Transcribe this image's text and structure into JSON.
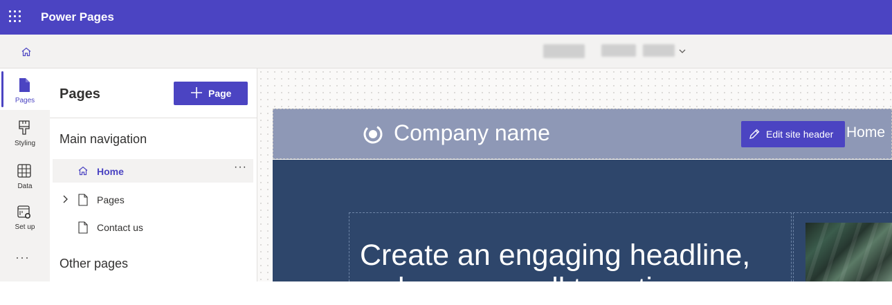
{
  "app": {
    "title": "Power Pages",
    "accent_color": "#4b44c2"
  },
  "command_bar": {
    "home_icon": "home-icon",
    "site_name": "",
    "site_name_redacted": true
  },
  "rail": {
    "items": [
      {
        "label": "Pages",
        "icon": "page-icon",
        "active": true
      },
      {
        "label": "Styling",
        "icon": "paintbrush-icon",
        "active": false
      },
      {
        "label": "Data",
        "icon": "table-icon",
        "active": false
      },
      {
        "label": "Set up",
        "icon": "setup-icon",
        "active": false
      }
    ],
    "more_label": "···"
  },
  "panel": {
    "title": "Pages",
    "add_button_label": "Page",
    "main_nav_title": "Main navigation",
    "main_nav_items": [
      {
        "label": "Home",
        "selected": true,
        "expandable": false,
        "more": "···"
      },
      {
        "label": "Pages",
        "selected": false,
        "expandable": true
      },
      {
        "label": "Contact us",
        "selected": false,
        "expandable": false
      }
    ],
    "other_pages_title": "Other pages"
  },
  "canvas": {
    "company_name": "Company name",
    "edit_header_label": "Edit site header",
    "header_nav_home": "Home",
    "hero_headline": "Create an engaging headline,",
    "hero_headline_next": "welcome or call to action",
    "header_bg": "#8e98b6",
    "hero_bg": "#2e466b"
  }
}
